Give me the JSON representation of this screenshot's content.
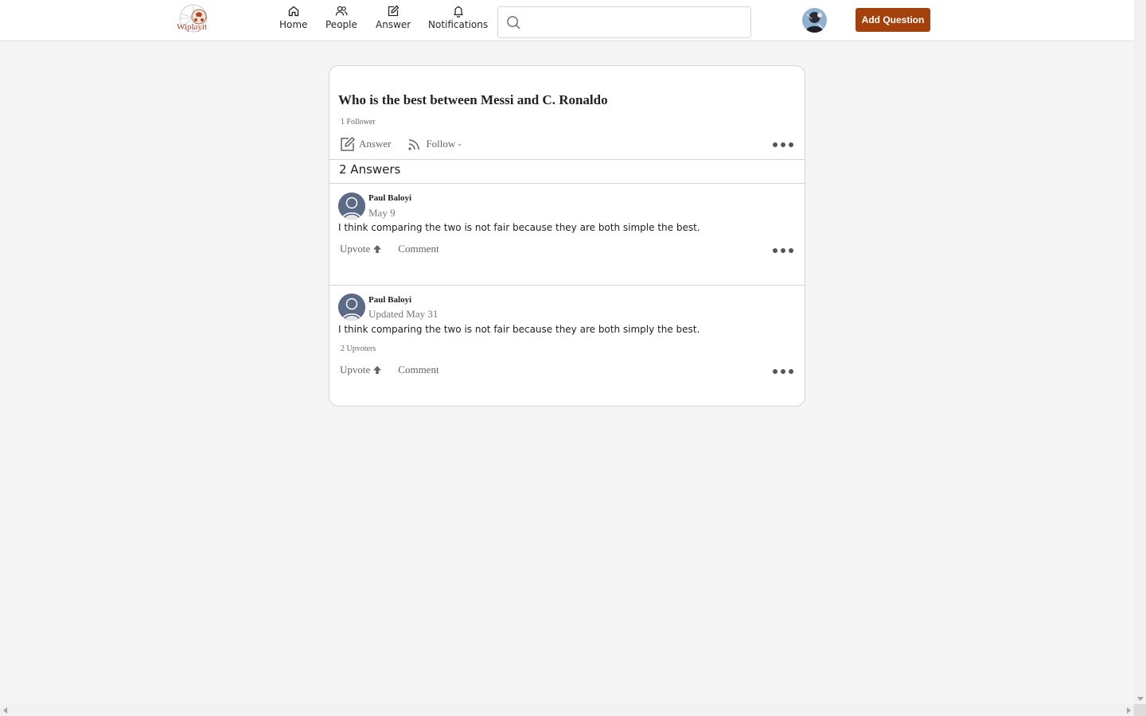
{
  "header": {
    "logo_text": "Wiplayit",
    "nav": [
      {
        "label": "Home",
        "icon": "home-icon"
      },
      {
        "label": "People",
        "icon": "people-icon"
      },
      {
        "label": "Answer",
        "icon": "edit-icon"
      },
      {
        "label": "Notifications",
        "icon": "bell-icon"
      }
    ],
    "search": {
      "placeholder": "",
      "value": ""
    },
    "add_question_label": "Add Question"
  },
  "question": {
    "title": "Who is the best between Messi and C. Ronaldo",
    "followers": "1 Follower",
    "answer_label": "Answer",
    "follow_label": "Follow -",
    "answers_count": "2 Answers"
  },
  "answers": [
    {
      "author": "Paul Baloyi",
      "date": "May 9",
      "text": "I think comparing the two is not fair because they are both simple the best.",
      "upvoters": "",
      "upvote_label": "Upvote",
      "comment_label": "Comment"
    },
    {
      "author": "Paul Baloyi",
      "date": "Updated May 31",
      "text": "I think comparing the two is not fair because they are both simply the best.",
      "upvoters": "2 Upvoters",
      "upvote_label": "Upvote",
      "comment_label": "Comment"
    }
  ],
  "colors": {
    "accent": "#a3400c",
    "background": "#f5f5f5",
    "card": "#ffffff"
  }
}
